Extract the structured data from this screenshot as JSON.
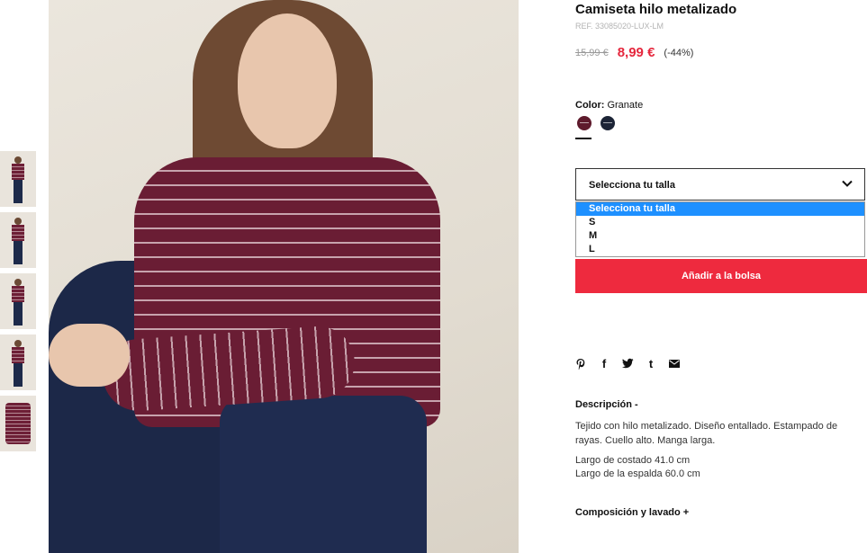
{
  "product": {
    "title": "Camiseta hilo metalizado",
    "ref": "REF. 33085020-LUX-LM",
    "old_price": "15,99 €",
    "new_price": "8,99 €",
    "discount": "(-44%)"
  },
  "color": {
    "label": "Color:",
    "value": "Granate",
    "swatches": [
      {
        "name": "Granate",
        "hex": "#5e1a2c"
      },
      {
        "name": "Navy",
        "hex": "#1c2436"
      }
    ]
  },
  "size": {
    "selected": "Selecciona tu talla",
    "options": [
      "Selecciona tu talla",
      "S",
      "M",
      "L"
    ]
  },
  "add_to_bag": "Añadir a la bolsa",
  "share_icons": [
    "pinterest-icon",
    "facebook-icon",
    "twitter-icon",
    "tumblr-icon",
    "email-icon"
  ],
  "share_glyphs": {
    "pinterest": "𝒑",
    "facebook": "f",
    "twitter": "🐦",
    "tumblr": "t",
    "email": "✉"
  },
  "description": {
    "title": "Descripción -",
    "text": "Tejido con hilo metalizado. Diseño entallado. Estampado de rayas. Cuello alto. Manga larga.",
    "measure_1": "Largo de costado 41.0 cm",
    "measure_2": "Largo de la espalda 60.0 cm"
  },
  "composition_title": "Composición y lavado +",
  "colors": {
    "accent": "#ee2a3e",
    "price": "#e5273d",
    "select_highlight": "#1e90ff"
  }
}
